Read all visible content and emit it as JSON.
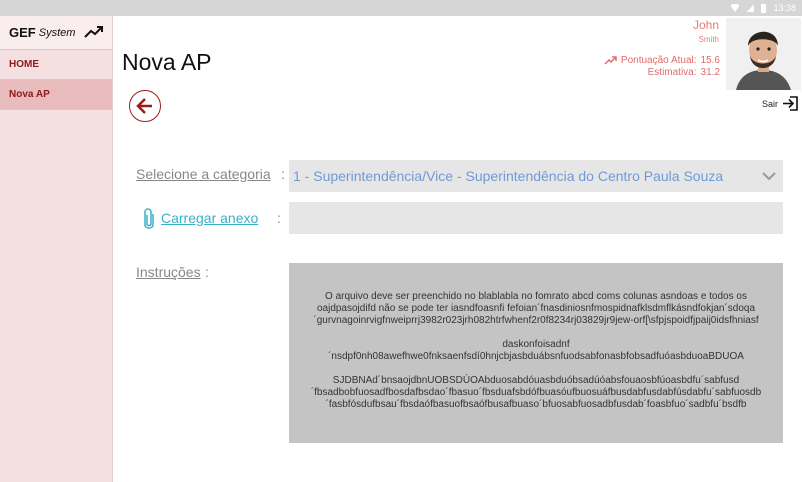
{
  "status_bar": {
    "time": "13:38"
  },
  "sidebar": {
    "brand_main": "GEF",
    "brand_sub": "System",
    "items": [
      {
        "label": "HOME"
      },
      {
        "label": "Nova AP"
      }
    ]
  },
  "page": {
    "title": "Nova AP"
  },
  "user": {
    "name": "John",
    "surname": "Smith",
    "score_label": "Pontuação Atual:",
    "score_value": "15.6",
    "estimate_label": "Estimativa:",
    "estimate_value": "31.2",
    "logout_label": "Sair"
  },
  "form": {
    "category_label": "Selecione a categoria",
    "category_value": "1 - Superintendência/Vice - Superintendência do Centro Paula Souza",
    "attach_label": "Carregar anexo",
    "instructions_label": "Instruções",
    "colon": ":",
    "instructions_p1": "O arquivo deve ser preenchido no blablabla no fomrato abcd coms colunas asndoas e todos os oajdpasojdifd não se pode ter iasndfoasnfi fefoian´fnasdiniosnfmospidnafklsdmflkásndfokjan´sdoqa ´gurvnagoinrvigfnweiprrj3982r023jrh082htrfwhenf2r0f8234rj03829jr9jew-orf[\\sfpjspoidfjpaij0idsfhniasf",
    "instructions_p2": "daskonfoisadnf ´nsdpf0nh08awefhwe0fnksaenfsdí0hnjcbjasbduábsnfuodsabfonasbfobsadfuóasbduoaBDUOA",
    "instructions_p3": "SJDBNAd´bnsaojdbnUOBSDÚOAbduosabdóuasbduóbsadúóabsfouaosbfúoasbdfu´sabfusd ´fbsadbobfuosadfbosdafbsdao´fbasuo´fbsduafsbdófbuasóufbuosuáfbusdabfusdabfúsdabfu´sabfuosdb ´fasbfósdufbsau´fbsdaófbasuofbsaófbusafbuaso´bfuosabfuosadbfusdab´foasbfuo´sadbfu´bsdfb"
  },
  "colors": {
    "accent": "#9e1b1b",
    "link": "#3ab0c8",
    "select_text": "#6f9ad8",
    "sidebar_bg": "#f4e0e0"
  }
}
